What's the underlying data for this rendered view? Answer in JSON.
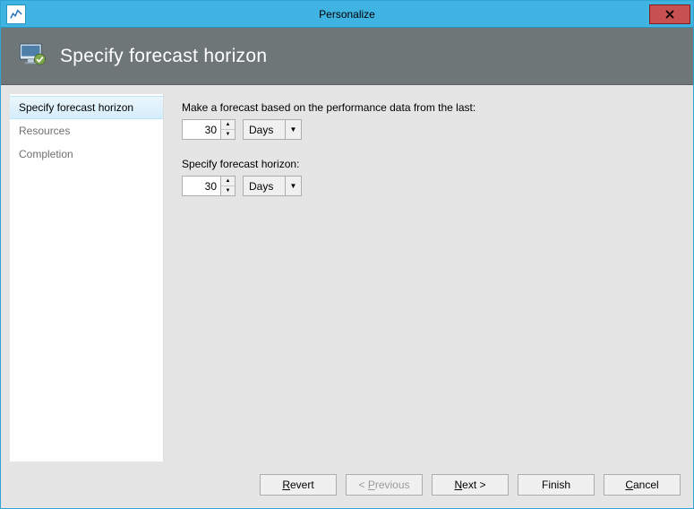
{
  "titlebar": {
    "title": "Personalize"
  },
  "header": {
    "title": "Specify forecast horizon"
  },
  "sidebar": {
    "steps": [
      {
        "label": "Specify forecast horizon",
        "active": true
      },
      {
        "label": "Resources",
        "active": false
      },
      {
        "label": "Completion",
        "active": false
      }
    ]
  },
  "content": {
    "history": {
      "label": "Make a forecast based on the performance data from the last:",
      "value": "30",
      "unit": "Days"
    },
    "horizon": {
      "label": "Specify forecast horizon:",
      "value": "30",
      "unit": "Days"
    }
  },
  "footer": {
    "revert": "Revert",
    "previous": "< Previous",
    "next": "Next >",
    "finish": "Finish",
    "cancel": "Cancel"
  }
}
